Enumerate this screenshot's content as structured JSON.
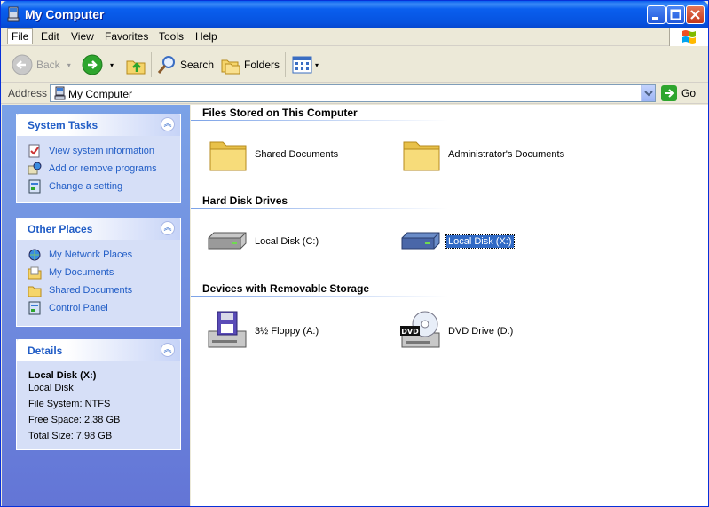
{
  "window": {
    "title": "My Computer"
  },
  "menubar": {
    "items": [
      "File",
      "Edit",
      "View",
      "Favorites",
      "Tools",
      "Help"
    ]
  },
  "toolbar": {
    "back": "Back",
    "search": "Search",
    "folders": "Folders"
  },
  "address": {
    "label": "Address",
    "value": "My Computer",
    "go": "Go"
  },
  "system_tasks": {
    "title": "System Tasks",
    "items": [
      "View system information",
      "Add or remove programs",
      "Change a setting"
    ]
  },
  "other_places": {
    "title": "Other Places",
    "items": [
      "My Network Places",
      "My Documents",
      "Shared Documents",
      "Control Panel"
    ]
  },
  "details": {
    "title": "Details",
    "name": "Local Disk (X:)",
    "type": "Local Disk",
    "filesystem": "File System: NTFS",
    "free": "Free Space: 2.38 GB",
    "total": "Total Size: 7.98 GB"
  },
  "groups": {
    "files": {
      "title": "Files Stored on This Computer",
      "items": [
        "Shared Documents",
        "Administrator's Documents"
      ]
    },
    "drives": {
      "title": "Hard Disk Drives",
      "items": [
        "Local Disk (C:)",
        "Local Disk (X:)"
      ]
    },
    "removable": {
      "title": "Devices with Removable Storage",
      "items": [
        "3½ Floppy (A:)",
        "DVD Drive (D:)"
      ],
      "dvd_badge": "DVD"
    }
  },
  "colors": {
    "taskbar_blue": "#215DC6",
    "selection": "#316AC5"
  }
}
